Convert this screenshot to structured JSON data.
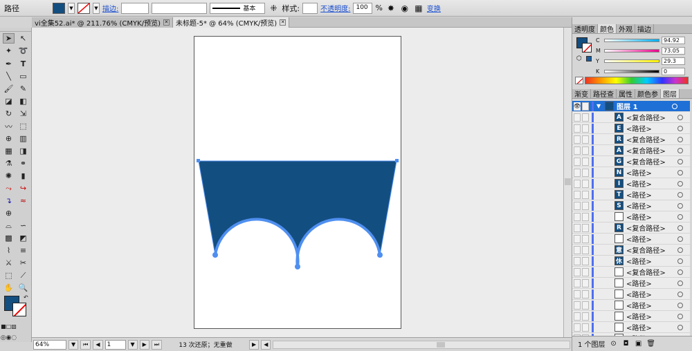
{
  "control_bar": {
    "object_type": "路径",
    "fill_color": "#134e80",
    "stroke_label": "描边:",
    "stroke_weight": "",
    "brush_label": "基本",
    "style_label": "样式:",
    "opacity_label": "不透明度:",
    "opacity_value": "100",
    "opacity_unit": "%",
    "transform_label": "变换"
  },
  "tabs": [
    {
      "label": "vi全集52.ai* @ 211.76% (CMYK/预览)",
      "active": false
    },
    {
      "label": "未标题-5* @ 64% (CMYK/预览)",
      "active": true
    }
  ],
  "shape": {
    "fill": "#134e80",
    "stroke": "#4f8ff0"
  },
  "status_bar": {
    "zoom": "64%",
    "artboard": "1",
    "undo_status": "13 次还原；无重做"
  },
  "color_panel": {
    "tabs": [
      "透明度",
      "颜色",
      "外观",
      "描边"
    ],
    "active_tab": "颜色",
    "fill": "#134e80",
    "sliders": [
      {
        "label": "C",
        "value": "94.92",
        "gradient": [
          "#ffffff",
          "#00aeef"
        ]
      },
      {
        "label": "M",
        "value": "73.05",
        "gradient": [
          "#ffffff",
          "#ec008c"
        ]
      },
      {
        "label": "Y",
        "value": "29.3",
        "gradient": [
          "#ffffff",
          "#fff200"
        ]
      },
      {
        "label": "K",
        "value": "0",
        "gradient": [
          "#ffffff",
          "#000000"
        ]
      }
    ]
  },
  "layers_panel": {
    "tabs": [
      "渐变",
      "路径查",
      "属性",
      "颜色参",
      "图层"
    ],
    "active_tab": "图层",
    "layer_name": "图层 1",
    "items": [
      {
        "name": "<复合路径>",
        "glyph": "A"
      },
      {
        "name": "<路径>",
        "glyph": "E"
      },
      {
        "name": "<复合路径>",
        "glyph": "R"
      },
      {
        "name": "<复合路径>",
        "glyph": "A"
      },
      {
        "name": "<复合路径>",
        "glyph": "G"
      },
      {
        "name": "<路径>",
        "glyph": "N"
      },
      {
        "name": "<路径>",
        "glyph": "I"
      },
      {
        "name": "<路径>",
        "glyph": "T"
      },
      {
        "name": "<路径>",
        "glyph": "S"
      },
      {
        "name": "<路径>",
        "glyph": ""
      },
      {
        "name": "<复合路径>",
        "glyph": "R"
      },
      {
        "name": "<路径>",
        "glyph": ""
      },
      {
        "name": "<复合路径>",
        "glyph": "意"
      },
      {
        "name": "<路径>",
        "glyph": "休"
      },
      {
        "name": "<复合路径>",
        "glyph": ""
      },
      {
        "name": "<路径>",
        "glyph": ""
      },
      {
        "name": "<路径>",
        "glyph": ""
      },
      {
        "name": "<路径>",
        "glyph": ""
      },
      {
        "name": "<路径>",
        "glyph": ""
      },
      {
        "name": "<路径>",
        "glyph": ""
      },
      {
        "name": "<路径>",
        "glyph": ""
      }
    ],
    "footer_label": "1 个图层"
  }
}
